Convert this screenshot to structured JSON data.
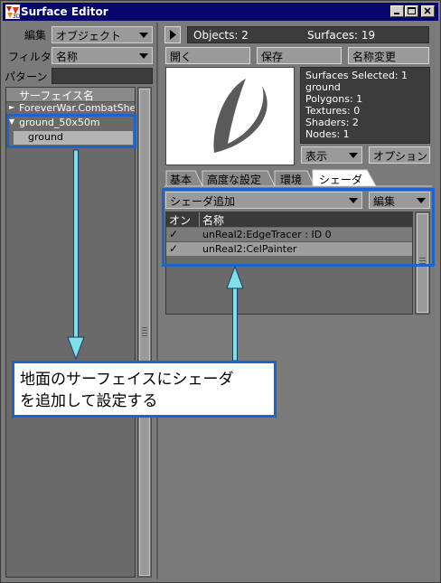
{
  "window": {
    "title": "Surface Editor"
  },
  "left_panel": {
    "edit_label": "編集",
    "edit_value": "オブジェクト",
    "filter_label": "フィルタ",
    "filter_value": "名称",
    "pattern_label": "パターン",
    "pattern_value": "",
    "list_header": "サーフェイス名",
    "items": [
      {
        "label": "ForeverWar.CombatShell",
        "expander": "►"
      },
      {
        "label": "ground_50x50m",
        "expander": "▼"
      },
      {
        "label": "ground",
        "expander": ""
      }
    ]
  },
  "top_bar": {
    "objects_text": "Objects: 2",
    "surfaces_text": "Surfaces: 19",
    "open_label": "開く",
    "save_label": "保存",
    "rename_label": "名称変更"
  },
  "info": {
    "lines": [
      "Surfaces Selected: 1",
      "ground",
      "Polygons: 1",
      "Textures: 0",
      "Shaders: 2",
      "Nodes: 1"
    ],
    "display_label": "表示",
    "options_label": "オプション"
  },
  "tabs": [
    {
      "label": "基本",
      "active": false
    },
    {
      "label": "高度な設定",
      "active": false
    },
    {
      "label": "環境",
      "active": false
    },
    {
      "label": "シェーダ",
      "active": true
    }
  ],
  "shader_panel": {
    "add_shader_label": "シェーダ追加",
    "edit_label": "編集",
    "col_on": "オン",
    "col_name": "名称",
    "rows": [
      {
        "check": "✓",
        "name": "unReal2:EdgeTracer : ID 0"
      },
      {
        "check": "✓",
        "name": "unReal2:CelPainter"
      }
    ]
  },
  "callout": {
    "text_line1": "地面のサーフェイスにシェーダ",
    "text_line2": "を追加して設定する"
  },
  "colors": {
    "title_bar": "#06066e",
    "callout_border": "#1c64c8",
    "arrow": "#7fe0e8"
  }
}
